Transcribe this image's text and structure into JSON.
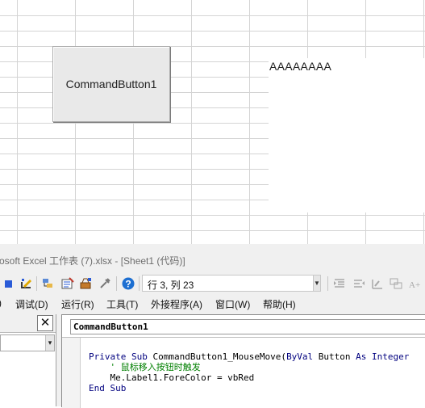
{
  "worksheet": {
    "command_button": {
      "caption": "CommandButton1"
    },
    "label": {
      "caption": "AAAAAAAA"
    }
  },
  "vbe": {
    "title": "osoft Excel 工作表 (7).xlsx - [Sheet1 (代码)]",
    "toolbar": {
      "position_text": "行 3, 列 23",
      "icons": [
        "stop-icon",
        "design-mode-icon",
        "project-explorer-icon",
        "properties-icon",
        "toolbox-icon",
        "object-browser-icon",
        "help-icon",
        "indent-icon",
        "outdent-icon",
        "toggle-breakpoint-icon",
        "comment-block-icon",
        "font-icon"
      ]
    },
    "menu": [
      "调试(D)",
      "运行(R)",
      "工具(T)",
      "外接程序(A)",
      "窗口(W)",
      "帮助(H)"
    ],
    "left_pane": {
      "close_glyph": "✕"
    },
    "code_window": {
      "object_selector": "CommandButton1",
      "lines": [
        [
          "Private Sub ",
          "CommandButton1_MouseMove(",
          "ByVal",
          " Button ",
          "As",
          " Integer"
        ],
        [
          "    ' 鼠标移入按钮时触发"
        ],
        [
          "    Me.Label1.ForeColor = vbRed"
        ],
        [
          "End Sub"
        ]
      ]
    }
  }
}
